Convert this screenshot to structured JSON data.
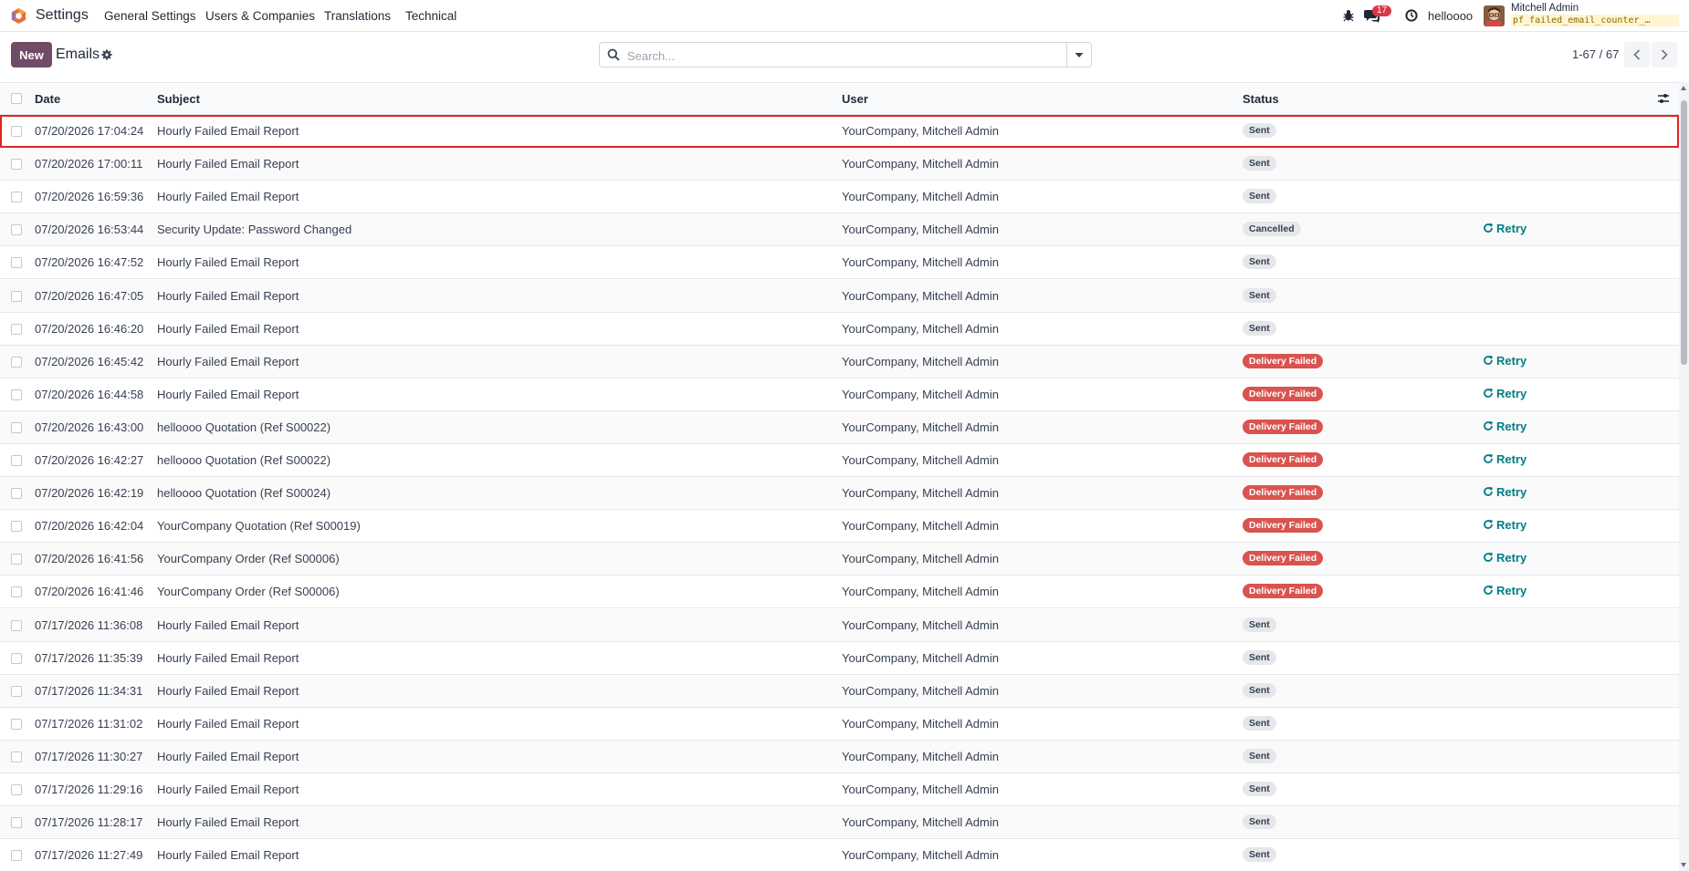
{
  "navbar": {
    "app_name": "Settings",
    "menu": [
      "General Settings",
      "Users & Companies",
      "Translations",
      "Technical"
    ],
    "messages_count": "17",
    "company": "helloooo",
    "user_name": "Mitchell Admin",
    "database": "pf_failed_email_counter_…"
  },
  "control": {
    "new_label": "New",
    "title": "Emails",
    "search_placeholder": "Search...",
    "pager": "1-67 / 67"
  },
  "table": {
    "headers": {
      "date": "Date",
      "subject": "Subject",
      "user": "User",
      "status": "Status"
    },
    "retry_label": "Retry",
    "rows": [
      {
        "date": "07/20/2026 17:04:24",
        "subject": "Hourly Failed Email Report",
        "user": "YourCompany, Mitchell Admin",
        "status": "Sent",
        "retry": false,
        "selected": true
      },
      {
        "date": "07/20/2026 17:00:11",
        "subject": "Hourly Failed Email Report",
        "user": "YourCompany, Mitchell Admin",
        "status": "Sent",
        "retry": false
      },
      {
        "date": "07/20/2026 16:59:36",
        "subject": "Hourly Failed Email Report",
        "user": "YourCompany, Mitchell Admin",
        "status": "Sent",
        "retry": false
      },
      {
        "date": "07/20/2026 16:53:44",
        "subject": "Security Update: Password Changed",
        "user": "YourCompany, Mitchell Admin",
        "status": "Cancelled",
        "retry": true
      },
      {
        "date": "07/20/2026 16:47:52",
        "subject": "Hourly Failed Email Report",
        "user": "YourCompany, Mitchell Admin",
        "status": "Sent",
        "retry": false
      },
      {
        "date": "07/20/2026 16:47:05",
        "subject": "Hourly Failed Email Report",
        "user": "YourCompany, Mitchell Admin",
        "status": "Sent",
        "retry": false
      },
      {
        "date": "07/20/2026 16:46:20",
        "subject": "Hourly Failed Email Report",
        "user": "YourCompany, Mitchell Admin",
        "status": "Sent",
        "retry": false
      },
      {
        "date": "07/20/2026 16:45:42",
        "subject": "Hourly Failed Email Report",
        "user": "YourCompany, Mitchell Admin",
        "status": "Delivery Failed",
        "retry": true
      },
      {
        "date": "07/20/2026 16:44:58",
        "subject": "Hourly Failed Email Report",
        "user": "YourCompany, Mitchell Admin",
        "status": "Delivery Failed",
        "retry": true
      },
      {
        "date": "07/20/2026 16:43:00",
        "subject": "helloooo Quotation (Ref S00022)",
        "user": "YourCompany, Mitchell Admin",
        "status": "Delivery Failed",
        "retry": true
      },
      {
        "date": "07/20/2026 16:42:27",
        "subject": "helloooo Quotation (Ref S00022)",
        "user": "YourCompany, Mitchell Admin",
        "status": "Delivery Failed",
        "retry": true
      },
      {
        "date": "07/20/2026 16:42:19",
        "subject": "helloooo Quotation (Ref S00024)",
        "user": "YourCompany, Mitchell Admin",
        "status": "Delivery Failed",
        "retry": true
      },
      {
        "date": "07/20/2026 16:42:04",
        "subject": "YourCompany Quotation (Ref S00019)",
        "user": "YourCompany, Mitchell Admin",
        "status": "Delivery Failed",
        "retry": true
      },
      {
        "date": "07/20/2026 16:41:56",
        "subject": "YourCompany Order (Ref S00006)",
        "user": "YourCompany, Mitchell Admin",
        "status": "Delivery Failed",
        "retry": true
      },
      {
        "date": "07/20/2026 16:41:46",
        "subject": "YourCompany Order (Ref S00006)",
        "user": "YourCompany, Mitchell Admin",
        "status": "Delivery Failed",
        "retry": true
      },
      {
        "date": "07/17/2026 11:36:08",
        "subject": "Hourly Failed Email Report",
        "user": "YourCompany, Mitchell Admin",
        "status": "Sent",
        "retry": false
      },
      {
        "date": "07/17/2026 11:35:39",
        "subject": "Hourly Failed Email Report",
        "user": "YourCompany, Mitchell Admin",
        "status": "Sent",
        "retry": false
      },
      {
        "date": "07/17/2026 11:34:31",
        "subject": "Hourly Failed Email Report",
        "user": "YourCompany, Mitchell Admin",
        "status": "Sent",
        "retry": false
      },
      {
        "date": "07/17/2026 11:31:02",
        "subject": "Hourly Failed Email Report",
        "user": "YourCompany, Mitchell Admin",
        "status": "Sent",
        "retry": false
      },
      {
        "date": "07/17/2026 11:30:27",
        "subject": "Hourly Failed Email Report",
        "user": "YourCompany, Mitchell Admin",
        "status": "Sent",
        "retry": false
      },
      {
        "date": "07/17/2026 11:29:16",
        "subject": "Hourly Failed Email Report",
        "user": "YourCompany, Mitchell Admin",
        "status": "Sent",
        "retry": false
      },
      {
        "date": "07/17/2026 11:28:17",
        "subject": "Hourly Failed Email Report",
        "user": "YourCompany, Mitchell Admin",
        "status": "Sent",
        "retry": false
      },
      {
        "date": "07/17/2026 11:27:49",
        "subject": "Hourly Failed Email Report",
        "user": "YourCompany, Mitchell Admin",
        "status": "Sent",
        "retry": false
      }
    ]
  },
  "colors": {
    "primary": "#714b67",
    "failed": "#d9534f",
    "retry": "#017e84",
    "selection": "#e02424"
  }
}
